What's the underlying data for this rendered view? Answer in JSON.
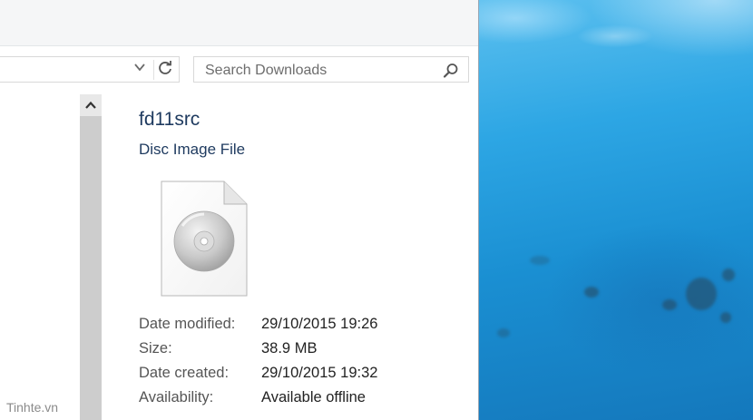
{
  "search": {
    "placeholder": "Search Downloads"
  },
  "preview": {
    "file_name": "fd11src",
    "file_type": "Disc Image File",
    "properties": [
      {
        "label": "Date modified:",
        "value": "29/10/2015 19:26"
      },
      {
        "label": "Size:",
        "value": "38.9 MB"
      },
      {
        "label": "Date created:",
        "value": "29/10/2015 19:32"
      },
      {
        "label": "Availability:",
        "value": "Available offline"
      }
    ]
  },
  "watermark": "Tinhte.vn",
  "icons": {
    "address_dropdown": "chevron-down-icon",
    "refresh": "refresh-icon",
    "search": "search-icon",
    "scroll_up": "chevron-up-icon",
    "file": "disc-image-file-icon"
  },
  "colors": {
    "title_text": "#1e3a5f",
    "wallpaper_blue": "#1e8fd0"
  }
}
